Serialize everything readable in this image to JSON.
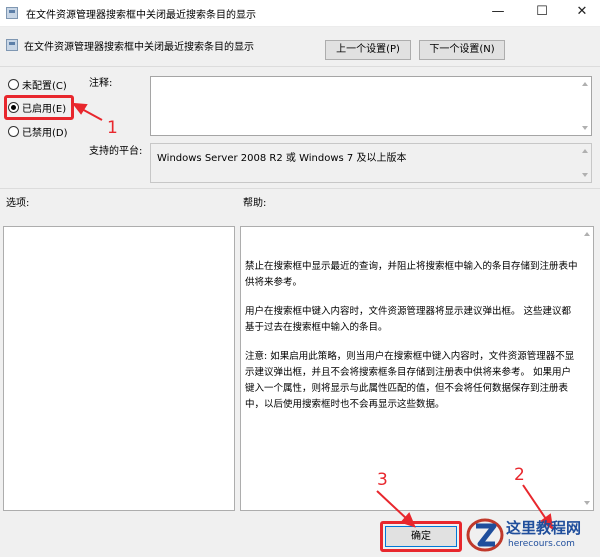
{
  "window": {
    "title": "在文件资源管理器搜索框中关闭最近搜索条目的显示",
    "controls": {
      "minimize": "—",
      "maximize": "☐",
      "close": "✕"
    }
  },
  "header": {
    "setting_title": "在文件资源管理器搜索框中关闭最近搜索条目的显示",
    "prev_button": "上一个设置(P)",
    "next_button": "下一个设置(N)"
  },
  "state": {
    "options": [
      {
        "label": "未配置(C)",
        "selected": false
      },
      {
        "label": "已启用(E)",
        "selected": true
      },
      {
        "label": "已禁用(D)",
        "selected": false
      }
    ]
  },
  "comment": {
    "label": "注释:",
    "value": ""
  },
  "platform": {
    "label": "支持的平台:",
    "value": "Windows Server 2008 R2 或 Windows 7 及以上版本"
  },
  "options_panel": {
    "label": "选项:"
  },
  "help_panel": {
    "label": "帮助:",
    "paragraphs": [
      "禁止在搜索框中显示最近的查询，并阻止将搜索框中输入的条目存储到注册表中供将来参考。",
      "用户在搜索框中键入内容时，文件资源管理器将显示建议弹出框。 这些建议都基于过去在搜索框中输入的条目。",
      "注意: 如果启用此策略，则当用户在搜索框中键入内容时，文件资源管理器不显示建议弹出框，并且不会将搜索框条目存储到注册表中供将来参考。 如果用户键入一个属性，则将显示与此属性匹配的值，但不会将任何数据保存到注册表中，以后使用搜索框时也不会再显示这些数据。"
    ]
  },
  "footer": {
    "ok_button": "确定"
  },
  "annotations": {
    "one": "1",
    "two": "2",
    "three": "3"
  },
  "watermark": {
    "main": "这里教程网",
    "url": "herecours.com"
  },
  "colors": {
    "accent_red": "#e8272d",
    "focus_blue": "#0078d7"
  }
}
